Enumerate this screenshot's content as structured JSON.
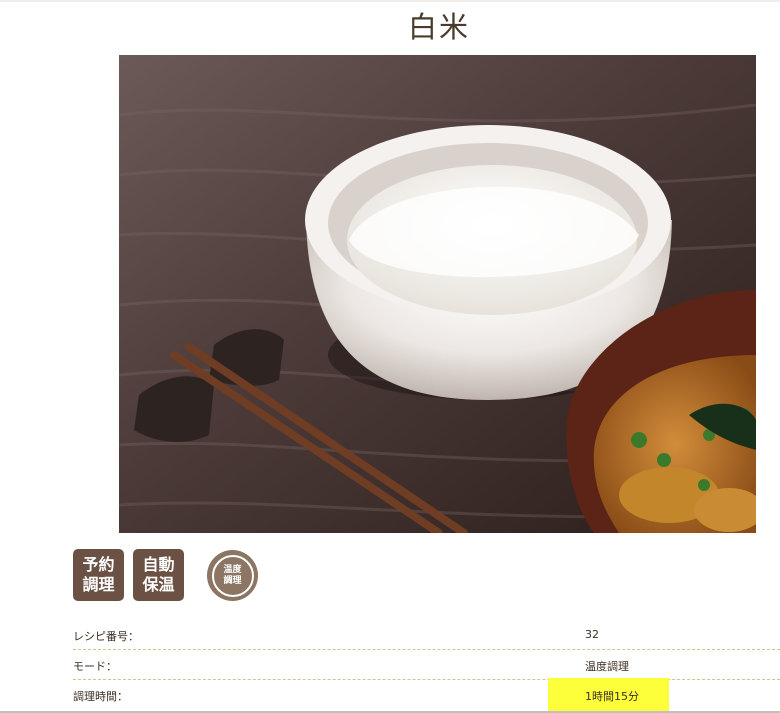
{
  "recipe": {
    "title": "白米"
  },
  "photo": {
    "alt": "白米",
    "icon": "rice-bowl-photo"
  },
  "badges": [
    {
      "line1": "予約",
      "line2": "調理"
    },
    {
      "line1": "自動",
      "line2": "保温"
    }
  ],
  "round_badge": {
    "line1": "温度",
    "line2": "調理"
  },
  "details": {
    "recipe_number_label": "レシピ番号：",
    "recipe_number_value": "32",
    "mode_label": "モード：",
    "mode_value": "温度調理",
    "time_label": "調理時間：",
    "time_value": "1時間15分"
  },
  "colors": {
    "badge_brown": "#6b5143",
    "round_badge": "#8c7563",
    "highlight": "#fdff3a",
    "divider": "#d6c28f"
  }
}
